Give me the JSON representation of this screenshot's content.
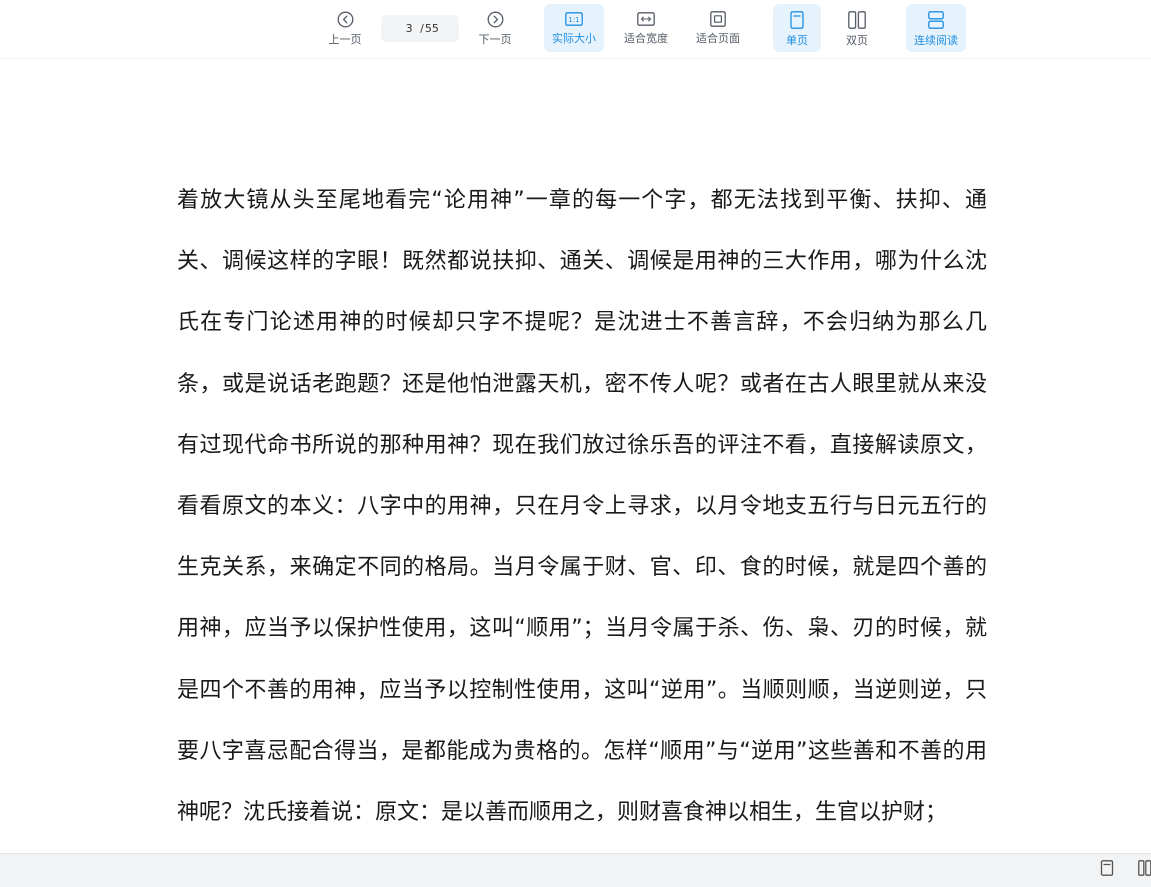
{
  "toolbar": {
    "prev_label": "上一页",
    "next_label": "下一页",
    "current_page": "3",
    "page_sep": "/",
    "total_pages": "55",
    "actual_size_label": "实际大小",
    "actual_size_icon_text": "1:1",
    "fit_width_label": "适合宽度",
    "fit_page_label": "适合页面",
    "single_page_label": "单页",
    "double_page_label": "双页",
    "continuous_label": "连续阅读",
    "accent_color": "#1f8fe0",
    "active_bg": "#e6f3fd",
    "icons": {
      "prev": "chevron-left-circle-icon",
      "next": "chevron-right-circle-icon",
      "actual_size": "actual-size-icon",
      "fit_width": "fit-width-icon",
      "fit_page": "fit-page-icon",
      "single_page": "single-page-icon",
      "double_page": "double-page-icon",
      "continuous": "continuous-read-icon"
    }
  },
  "document": {
    "body_text": "着放大镜从头至尾地看完“论用神”一章的每一个字，都无法找到平衡、扶抑、通关、调候这样的字眼！既然都说扶抑、通关、调候是用神的三大作用，哪为什么沈氏在专门论述用神的时候却只字不提呢？是沈进士不善言辞，不会归纳为那么几条，或是说话老跑题？还是他怕泄露天机，密不传人呢？或者在古人眼里就从来没有过现代命书所说的那种用神？现在我们放过徐乐吾的评注不看，直接解读原文，看看原文的本义：八字中的用神，只在月令上寻求，以月令地支五行与日元五行的生克关系，来确定不同的格局。当月令属于财、官、印、食的时候，就是四个善的用神，应当予以保护性使用，这叫“顺用”；当月令属于杀、伤、枭、刃的时候，就是四个不善的用神，应当予以控制性使用，这叫“逆用”。当顺则顺，当逆则逆，只要八字喜忌配合得当，是都能成为贵格的。怎样“顺用”与“逆用”这些善和不善的用神呢？沈氏接着说：原文：是以善而顺用之，则财喜食神以相生，生官以护财；"
  },
  "statusbar": {
    "icons": [
      "single-page-icon",
      "double-page-icon"
    ]
  }
}
